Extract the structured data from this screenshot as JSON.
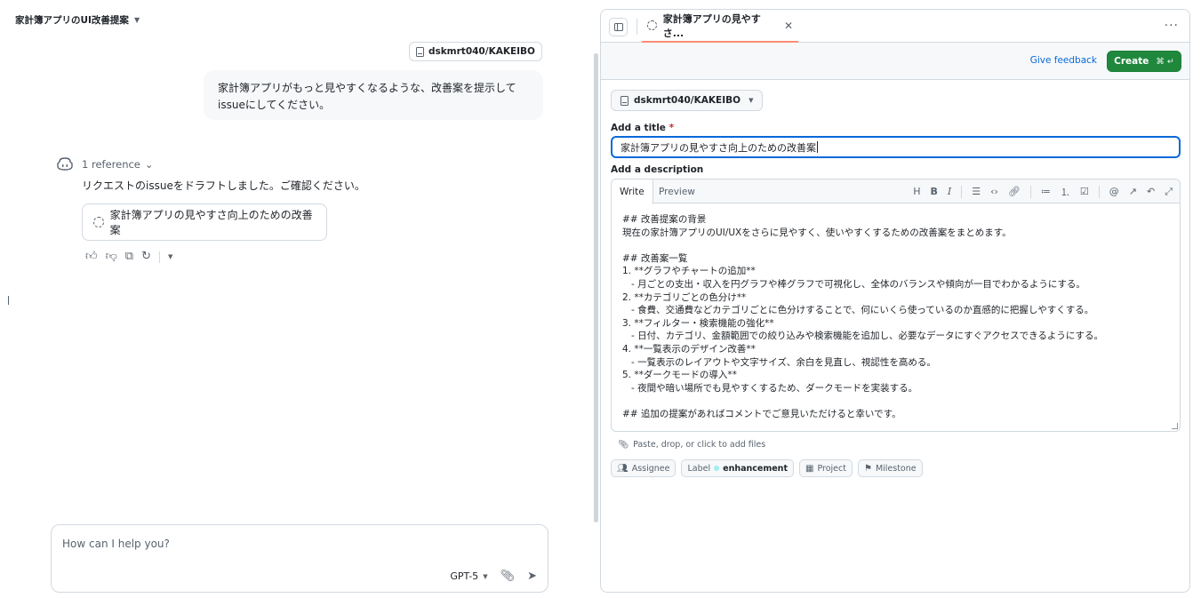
{
  "conversation": {
    "title": "家計簿アプリのUI改善提案",
    "repo": "dskmrt040/KAKEIBO",
    "user_message": "家計簿アプリがもっと見やすくなるような、改善案を提示して issueにしてください。",
    "references": "1 reference",
    "assistant_text": "リクエストのissueをドラフトしました。ご確認ください。",
    "issue_card_title": "家計簿アプリの見やすさ向上のための改善案",
    "chat_placeholder": "How can I help you?",
    "model": "GPT-5"
  },
  "icons": {
    "repo": "repo-icon",
    "copilot": "copilot-icon",
    "thumbs_up": "thumbs-up-icon",
    "thumbs_down": "thumbs-down-icon",
    "copy": "copy-icon",
    "retry": "retry-icon",
    "attach": "paperclip-icon",
    "send": "send-icon"
  },
  "issue_panel": {
    "tab_title": "家計簿アプリの見やすさ...",
    "give_feedback": "Give feedback",
    "create_label": "Create",
    "create_shortcut": "⌘ ↵",
    "repo": "dskmrt040/KAKEIBO",
    "title_label": "Add a title",
    "required_mark": "*",
    "title_value": "家計簿アプリの見やすさ向上のための改善案",
    "description_label": "Add a description",
    "tab_write": "Write",
    "tab_preview": "Preview",
    "description": "## 改善提案の背景\n現在の家計簿アプリのUI/UXをさらに見やすく、使いやすくするための改善案をまとめます。\n\n## 改善案一覧\n1. **グラフやチャートの追加**\n   - 月ごとの支出・収入を円グラフや棒グラフで可視化し、全体のバランスや傾向が一目でわかるようにする。\n2. **カテゴリごとの色分け**\n   - 食費、交通費などカテゴリごとに色分けすることで、何にいくら使っているのか直感的に把握しやすくする。\n3. **フィルター・検索機能の強化**\n   - 日付、カテゴリ、金額範囲での絞り込みや検索機能を追加し、必要なデータにすぐアクセスできるようにする。\n4. **一覧表示のデザイン改善**\n   - 一覧表示のレイアウトや文字サイズ、余白を見直し、視認性を高める。\n5. **ダークモードの導入**\n   - 夜間や暗い場所でも見やすくするため、ダークモードを実装する。\n\n## 追加の提案があればコメントでご意見いただけると幸いです。",
    "attach_hint": "Paste, drop, or click to add files",
    "assignee": "Assignee",
    "label_key": "Label",
    "label_value": "enhancement",
    "project": "Project",
    "milestone": "Milestone"
  }
}
